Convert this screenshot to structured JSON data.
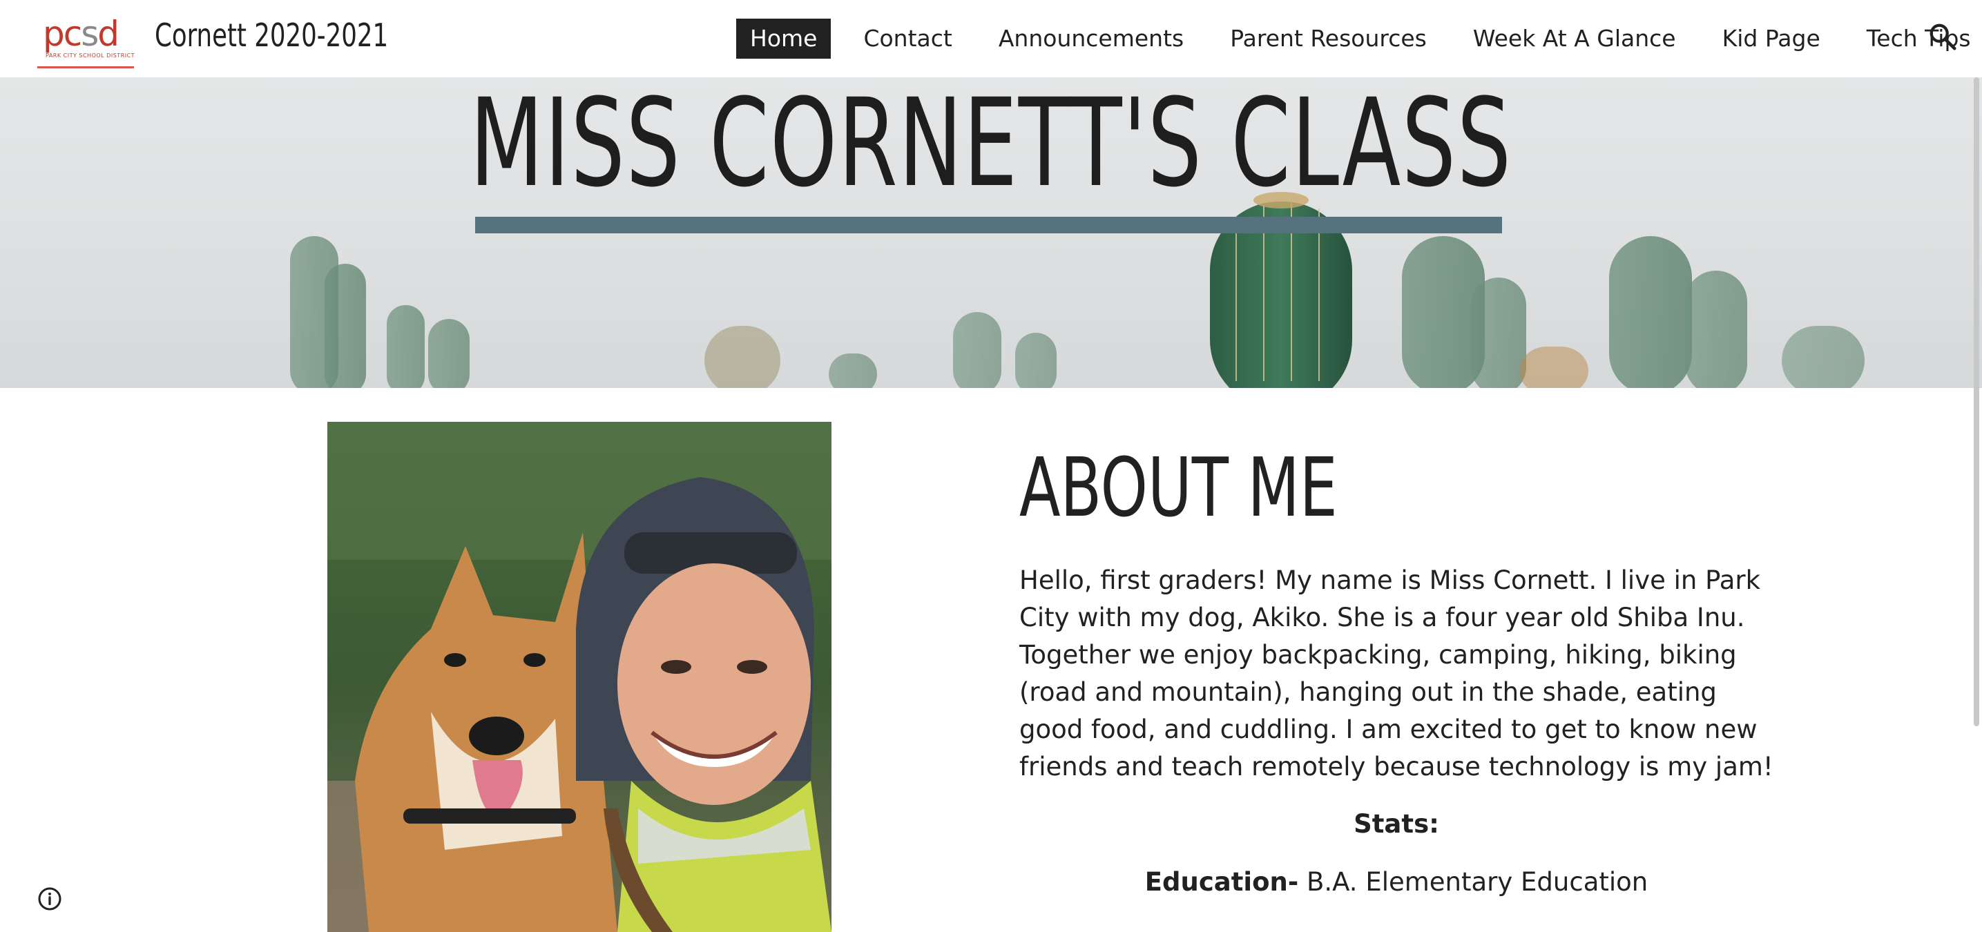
{
  "header": {
    "logo": {
      "letters_red_1": "pc",
      "letters_gray": "s",
      "letters_red_2": "d",
      "subtitle": "PARK CITY SCHOOL DISTRICT"
    },
    "site_title": "Cornett 2020-2021",
    "nav": [
      {
        "label": "Home",
        "active": true
      },
      {
        "label": "Contact",
        "active": false
      },
      {
        "label": "Announcements",
        "active": false
      },
      {
        "label": "Parent Resources",
        "active": false
      },
      {
        "label": "Week At A Glance",
        "active": false
      },
      {
        "label": "Kid Page",
        "active": false
      },
      {
        "label": "Tech Tips",
        "active": false
      }
    ],
    "search_icon": "search-icon"
  },
  "hero": {
    "title": "MISS CORNETT'S CLASS",
    "bar_color": "#56727f"
  },
  "about": {
    "title": "ABOUT ME",
    "bio": "Hello, first graders! My name is Miss Cornett. I live in Park City with my dog, Akiko. She is a four year old Shiba Inu. Together we enjoy backpacking, camping, hiking, biking (road and mountain), hanging out in the shade, eating good food, and cuddling. I am excited to get to know new friends and teach remotely because technology is my jam!",
    "stats_label": "Stats:",
    "education_label": "Education-",
    "education_value": " B.A. Elementary Education"
  },
  "footer": {
    "info_icon": "info-icon"
  }
}
